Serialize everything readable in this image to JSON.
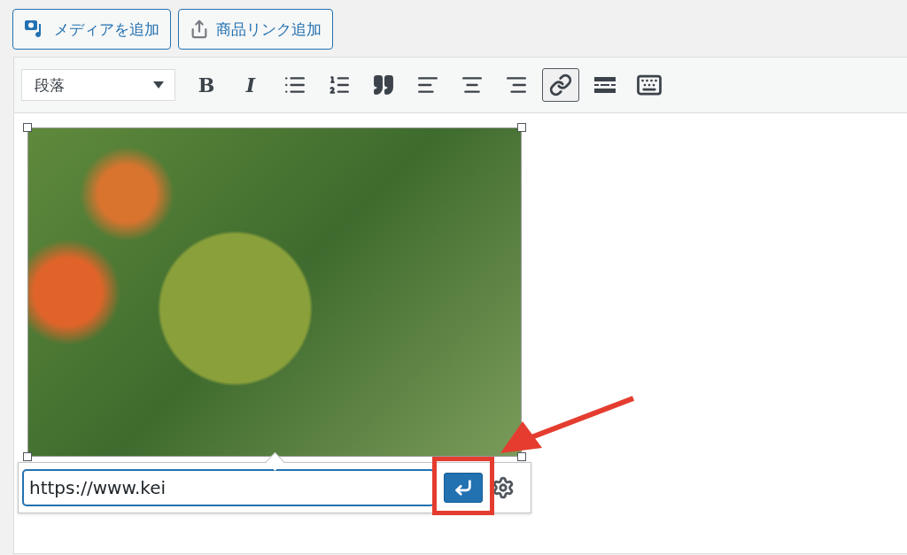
{
  "media_buttons": [
    {
      "kind": "media",
      "label": "メディアを追加"
    },
    {
      "kind": "product",
      "label": "商品リンク追加"
    }
  ],
  "toolbar": {
    "format_select": {
      "value": "段落"
    },
    "buttons": [
      {
        "kind": "bold",
        "label": "B",
        "selected": false
      },
      {
        "kind": "italic",
        "label": "I",
        "selected": false
      },
      {
        "kind": "bullet_list",
        "selected": false
      },
      {
        "kind": "numbered_list",
        "selected": false
      },
      {
        "kind": "quote",
        "selected": false
      },
      {
        "kind": "align_left",
        "selected": false
      },
      {
        "kind": "align_center",
        "selected": false
      },
      {
        "kind": "align_right",
        "selected": false
      },
      {
        "kind": "link",
        "selected": true
      },
      {
        "kind": "more",
        "selected": false
      },
      {
        "kind": "toolbar_toggle",
        "selected": false
      }
    ]
  },
  "link_popup": {
    "url": {
      "value": "https://www.kei"
    }
  }
}
